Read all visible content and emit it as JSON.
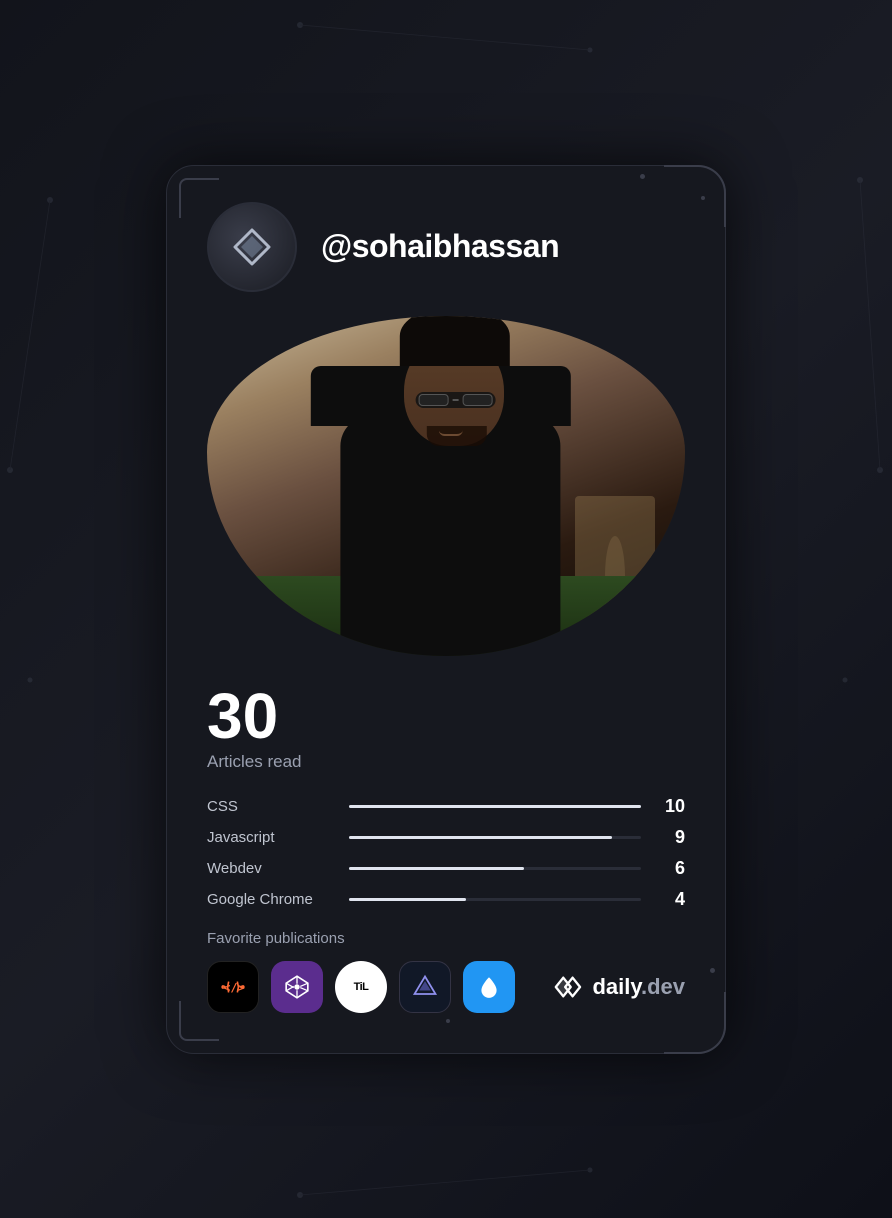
{
  "card": {
    "username": "@sohaibhassan",
    "articles_count": "30",
    "articles_label": "Articles read",
    "tags": [
      {
        "name": "CSS",
        "count": "10",
        "pct": 100
      },
      {
        "name": "Javascript",
        "count": "9",
        "pct": 90
      },
      {
        "name": "Webdev",
        "count": "6",
        "pct": 60
      },
      {
        "name": "Google Chrome",
        "count": "4",
        "pct": 40
      }
    ],
    "publications_label": "Favorite publications",
    "publications": [
      {
        "id": "fcc",
        "label": "freeCodeCamp"
      },
      {
        "id": "codepen",
        "label": "CodePen"
      },
      {
        "id": "til",
        "label": "TIL"
      },
      {
        "id": "three",
        "label": "Three.js"
      },
      {
        "id": "droplet",
        "label": "Droplet"
      }
    ],
    "brand": {
      "name": "daily",
      "suffix": ".dev"
    }
  },
  "colors": {
    "background": "#16181f",
    "text_primary": "#ffffff",
    "text_secondary": "#9aa0b0",
    "accent": "#5865f2",
    "bar_fill": "#e0e4ee"
  }
}
